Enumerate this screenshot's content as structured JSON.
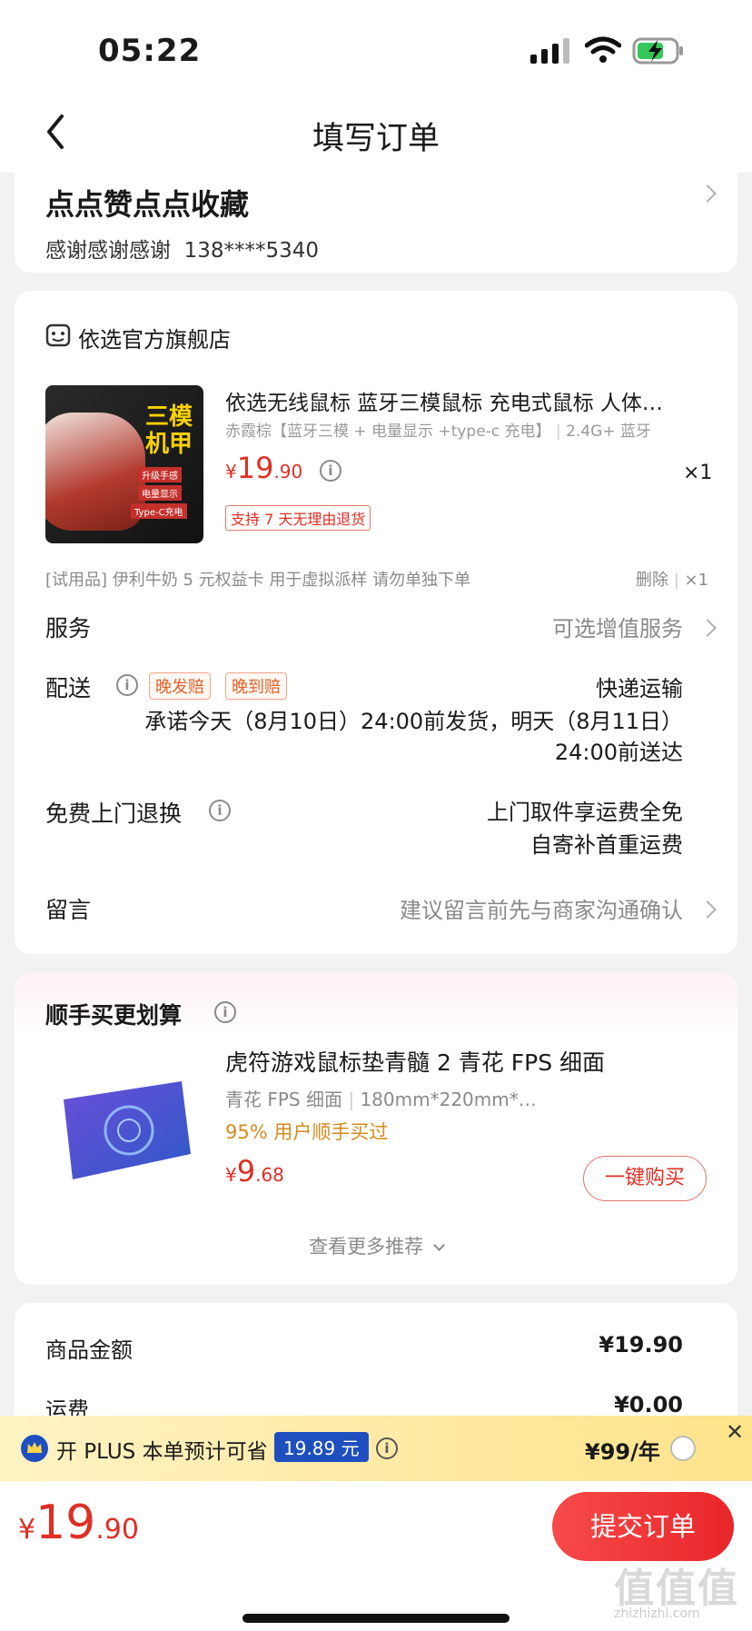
{
  "status": {
    "time": "05:22"
  },
  "header": {
    "title": "填写订单"
  },
  "address": {
    "name": "点点赞点点收藏",
    "receiver": "感谢感谢感谢",
    "phone": "138****5340"
  },
  "store": {
    "name": "依选官方旗舰店"
  },
  "product": {
    "thumb_line1": "三模",
    "thumb_line2": "机甲",
    "thumb_chips": [
      "升级手感",
      "电量显示",
      "Type-C充电"
    ],
    "title": "依选无线鼠标 蓝牙三模鼠标 充电式鼠标 人体…",
    "spec": "赤霞棕【蓝牙三模 + 电量显示 +type-c 充电】",
    "spec2": "2.4G+ 蓝牙",
    "price_symbol": "¥",
    "price_int": "19",
    "price_dec": ".90",
    "qty": "×1",
    "return_tag": "支持 7 天无理由退货"
  },
  "trial": {
    "text": "[试用品] 伊利牛奶 5 元权益卡 用于虚拟派样 请勿单独下单",
    "delete": "删除",
    "qty": "×1"
  },
  "service": {
    "label": "服务",
    "value": "可选增值服务"
  },
  "delivery": {
    "label": "配送",
    "tag1": "晚发赔",
    "tag2": "晚到赔",
    "method": "快递运输",
    "line1": "承诺今天（8月10日）24:00前发货，明天（8月11日）",
    "line2": "24:00前送达"
  },
  "return_service": {
    "label": "免费上门退换",
    "line1": "上门取件享运费全免",
    "line2": "自寄补首重运费"
  },
  "message": {
    "label": "留言",
    "placeholder": "建议留言前先与商家沟通确认"
  },
  "recommend": {
    "title": "顺手买更划算",
    "item_title": "虎符游戏鼠标垫青髓 2 青花 FPS 细面",
    "spec1": "青花 FPS 细面",
    "spec2": "180mm*220mm*…",
    "social": "95% 用户顺手买过",
    "price_symbol": "¥",
    "price_int": "9",
    "price_dec": ".68",
    "buy_button": "一键购买",
    "more": "查看更多推荐"
  },
  "summary": {
    "goods_label": "商品金额",
    "goods_value": "¥19.90",
    "shipping_label": "运费",
    "shipping_value": "¥0.00"
  },
  "plus": {
    "text": "开 PLUS 本单预计可省",
    "amount": "19.89 元",
    "price": "¥99/年"
  },
  "footer": {
    "price_symbol": "¥",
    "price_int": "19",
    "price_dec": ".90",
    "submit": "提交订单"
  },
  "watermark": {
    "text": "值值值",
    "url": "zhizhizhi.com"
  },
  "colors": {
    "accent": "#e02e24",
    "tag_orange": "#e0642a",
    "plus_blue": "#1f4fbf",
    "bg": "#f2f2f2"
  }
}
